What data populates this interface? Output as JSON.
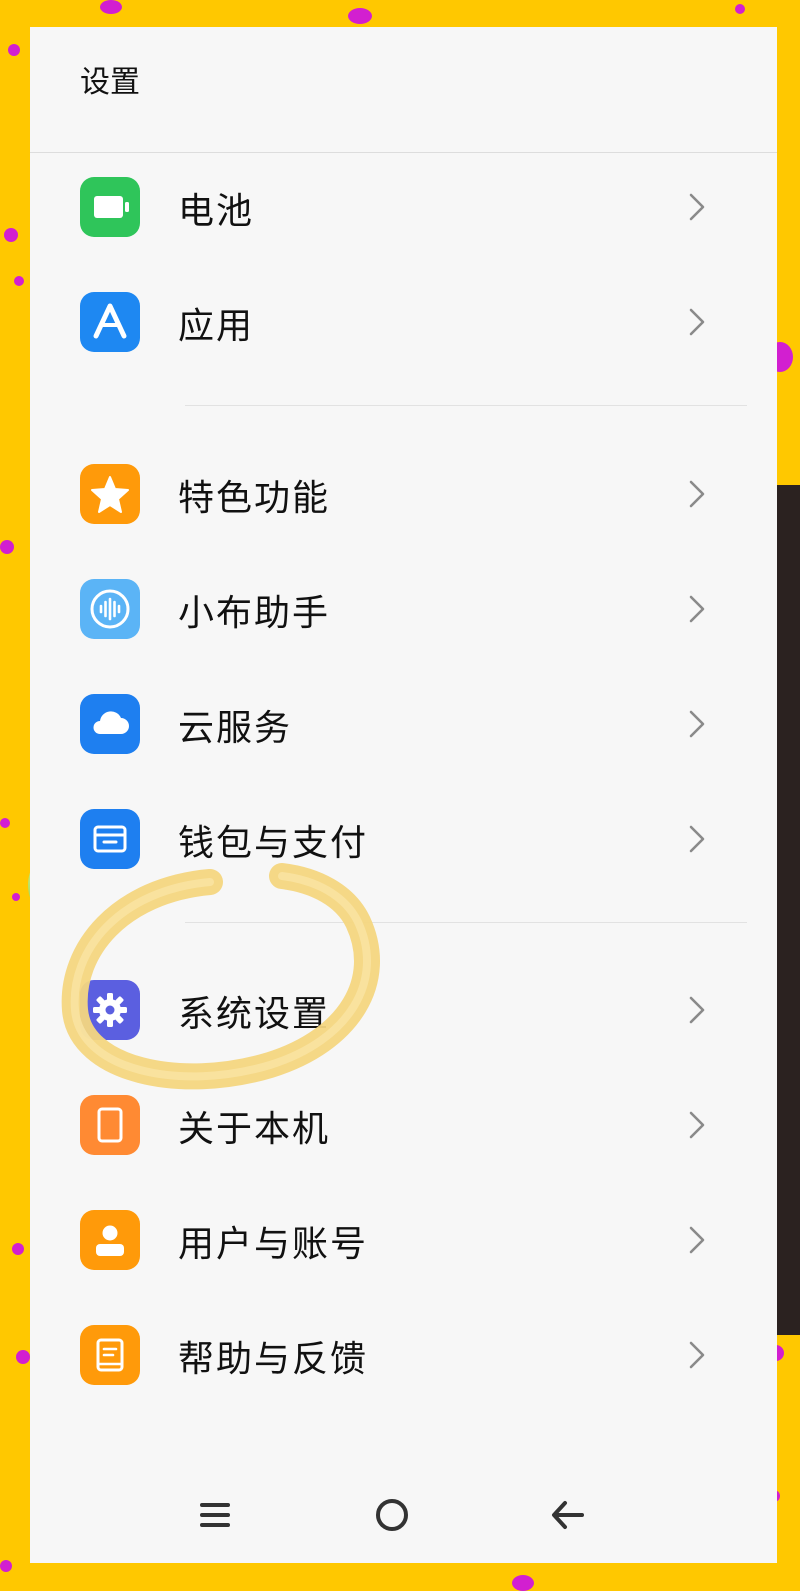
{
  "header": {
    "title": "设置"
  },
  "rows": [
    {
      "label": "电池",
      "icon": "battery-icon",
      "color": "#2FC55A"
    },
    {
      "label": "应用",
      "icon": "apps-icon",
      "color": "#1E88F2"
    },
    {
      "label": "特色功能",
      "icon": "star-icon",
      "color": "#FF9A0A"
    },
    {
      "label": "小布助手",
      "icon": "voice-assistant-icon",
      "color": "#5BB4F6"
    },
    {
      "label": "云服务",
      "icon": "cloud-icon",
      "color": "#1E7FF0"
    },
    {
      "label": "钱包与支付",
      "icon": "wallet-icon",
      "color": "#1E7FF0"
    },
    {
      "label": "系统设置",
      "icon": "gear-icon",
      "color": "#5B5FE0"
    },
    {
      "label": "关于本机",
      "icon": "phone-icon",
      "color": "#FF8A33"
    },
    {
      "label": "用户与账号",
      "icon": "user-icon",
      "color": "#FF9A0A"
    },
    {
      "label": "帮助与反馈",
      "icon": "help-book-icon",
      "color": "#FF9A0A"
    }
  ],
  "navbar": {
    "items": [
      "menu-icon",
      "home-icon",
      "back-icon"
    ]
  },
  "overlay": {
    "color": "#F4D680",
    "icon": "highlight-circle"
  }
}
